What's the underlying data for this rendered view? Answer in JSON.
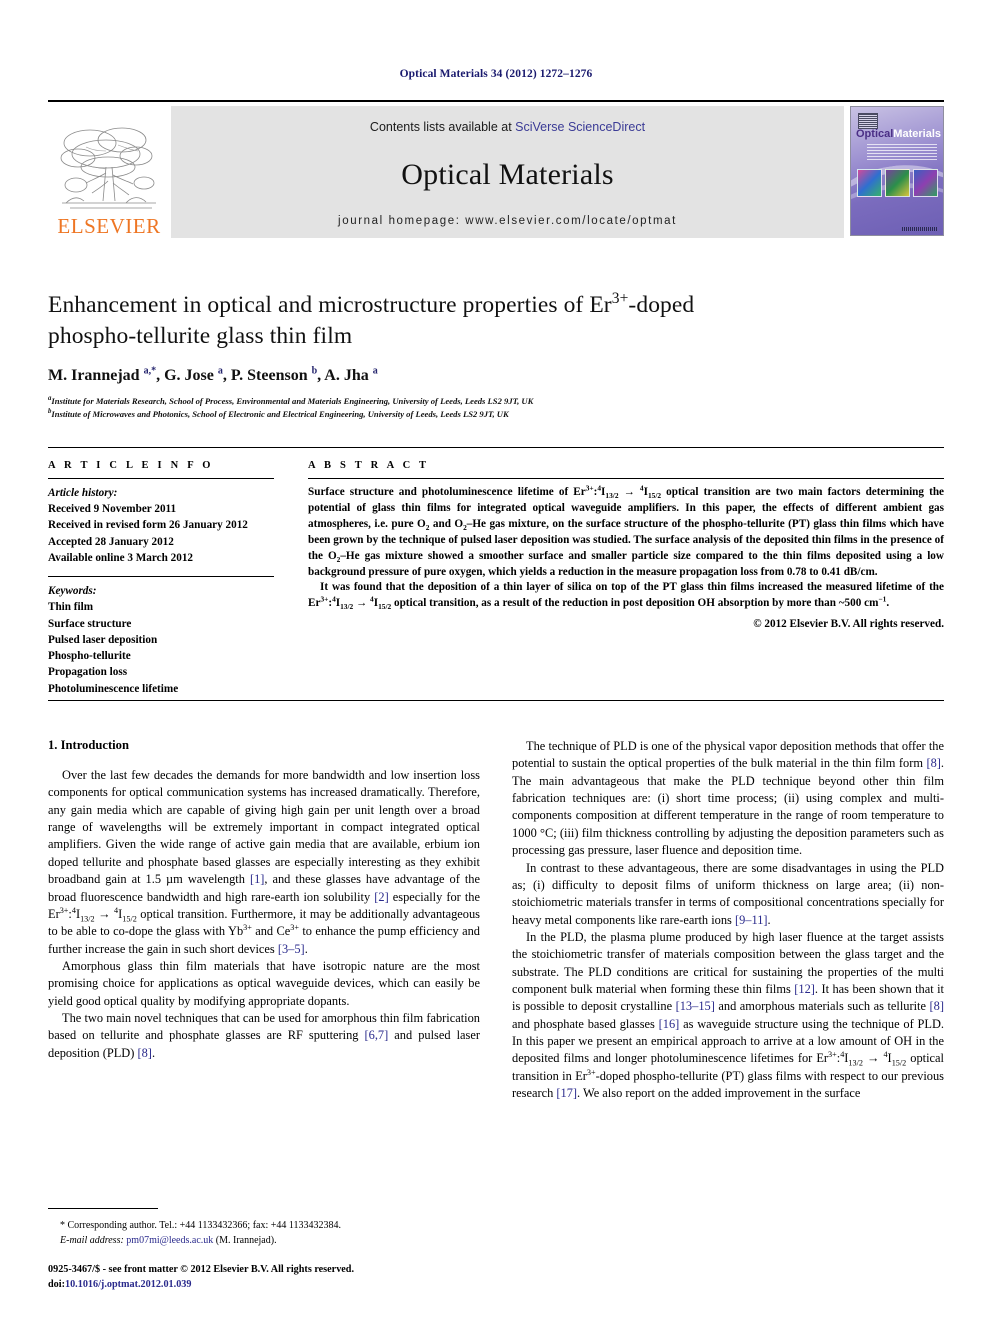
{
  "running_head": "Optical Materials 34 (2012) 1272–1276",
  "masthead": {
    "publisher_name": "ELSEVIER",
    "contents_prefix": "Contents lists available at ",
    "sciencedirect_link": "SciVerse ScienceDirect",
    "journal_title": "Optical Materials",
    "homepage_line": "journal homepage: www.elsevier.com/locate/optmat",
    "cover": {
      "title_part1": "Optical",
      "title_part2": "Materials"
    }
  },
  "article": {
    "title_line1": "Enhancement in optical and microstructure properties of Er",
    "title_sup1": "3+",
    "title_line1_end": "-doped",
    "title_line2": "phospho-tellurite glass thin film",
    "authors_html": "M. Irannejad <sup>a,*</sup>, G. Jose <sup>a</sup>, P. Steenson <sup>b</sup>, A. Jha <sup>a</sup>",
    "affiliation_a": "Institute for Materials Research, School of Process, Environmental and Materials Engineering, University of Leeds, Leeds LS2 9JT, UK",
    "affiliation_b": "Institute of Microwaves and Photonics, School of Electronic and Electrical Engineering, University of Leeds, Leeds LS2 9JT, UK"
  },
  "article_info": {
    "heading": "A R T I C L E   I N F O",
    "history_label": "Article history:",
    "history": [
      "Received 9 November 2011",
      "Received in revised form 26 January 2012",
      "Accepted 28 January 2012",
      "Available online 3 March 2012"
    ],
    "keywords_label": "Keywords:",
    "keywords": [
      "Thin film",
      "Surface structure",
      "Pulsed laser deposition",
      "Phospho-tellurite",
      "Propagation loss",
      "Photoluminescence lifetime"
    ]
  },
  "abstract": {
    "heading": "A B S T R A C T",
    "paragraph1_html": "Surface structure and photoluminescence lifetime of Er<sup>3+</sup>:<sup>4</sup>I<sub>13/2</sub> &#8594; <sup>4</sup>I<sub>15/2</sub> optical transition are two main factors determining the potential of glass thin films for integrated optical waveguide amplifiers. In this paper, the effects of different ambient gas atmospheres, i.e. pure O<sub>2</sub> and O<sub>2</sub>&#8211;He gas mixture, on the surface structure of the phospho-tellurite (PT) glass thin films which have been grown by the technique of pulsed laser deposition was studied. The surface analysis of the deposited thin films in the presence of the O<sub>2</sub>&#8211;He gas mixture showed a smoother surface and smaller particle size compared to the thin films deposited using a low background pressure of pure oxygen, which yields a reduction in the measure propagation loss from 0.78 to 0.41 dB/cm.",
    "paragraph2_html": "It was found that the deposition of a thin layer of silica on top of the PT glass thin films increased the measured lifetime of the Er<sup>3+</sup>:<sup>4</sup>I<sub>13/2</sub> &#8594; <sup>4</sup>I<sub>15/2</sub> optical transition, as a result of the reduction in post deposition OH absorption by more than ~500 cm<sup>&#8722;1</sup>.",
    "copyright": "© 2012 Elsevier B.V. All rights reserved."
  },
  "body": {
    "section_number_title": "1. Introduction",
    "left_paragraphs_html": [
      "Over the last few decades the demands for more bandwidth and low insertion loss components for optical communication systems has increased dramatically. Therefore, any gain media which are capable of giving high gain per unit length over a broad range of wavelengths will be extremely important in compact integrated optical amplifiers. Given the wide range of active gain media that are available, erbium ion doped tellurite and phosphate based glasses are especially interesting as they exhibit broadband gain at 1.5 &#181;m wavelength <span class=\"ref\">[1]</span>, and these glasses have advantage of the broad fluorescence bandwidth and high rare-earth ion solubility <span class=\"ref\">[2]</span> especially for the Er<sup>3+</sup>:<sup>4</sup>I<sub>13/2</sub> &#8594; <sup>4</sup>I<sub>15/2</sub> optical transition. Furthermore, it may be additionally advantageous to be able to co-dope the glass with Yb<sup>3+</sup> and Ce<sup>3+</sup> to enhance the pump efficiency and further increase the gain in such short devices <span class=\"ref\">[3&#8211;5]</span>.",
      "Amorphous glass thin film materials that have isotropic nature are the most promising choice for applications as optical waveguide devices, which can easily be yield good optical quality by modifying appropriate dopants.",
      "The two main novel techniques that can be used for amorphous thin film fabrication based on tellurite and phosphate glasses are RF sputtering <span class=\"ref\">[6,7]</span> and pulsed laser deposition (PLD) <span class=\"ref\">[8]</span>."
    ],
    "right_paragraphs_html": [
      "The technique of PLD is one of the physical vapor deposition methods that offer the potential to sustain the optical properties of the bulk material in the thin film form <span class=\"ref\">[8]</span>. The main advantageous that make the PLD technique beyond other thin film fabrication techniques are: (i) short time process; (ii) using complex and multi-components composition at different temperature in the range of room temperature to 1000 &#176;C; (iii) film thickness controlling by adjusting the deposition parameters such as processing gas pressure, laser fluence and deposition time.",
      "In contrast to these advantageous, there are some disadvantages in using the PLD as; (i) difficulty to deposit films of uniform thickness on large area; (ii) non-stoichiometric materials transfer in terms of compositional concentrations specially for heavy metal components like rare-earth ions <span class=\"ref\">[9&#8211;11]</span>.",
      "In the PLD, the plasma plume produced by high laser fluence at the target assists the stoichiometric transfer of materials composition between the glass target and the substrate. The PLD conditions are critical for sustaining the properties of the multi component bulk material when forming these thin films <span class=\"ref\">[12]</span>. It has been shown that it is possible to deposit crystalline <span class=\"ref\">[13&#8211;15]</span> and amorphous materials such as tellurite <span class=\"ref\">[8]</span> and phosphate based glasses <span class=\"ref\">[16]</span> as waveguide structure using the technique of PLD. In this paper we present an empirical approach to arrive at a low amount of OH in the deposited films and longer photoluminescence lifetimes for Er<sup>3+</sup>:<sup>4</sup>I<sub>13/2</sub> &#8594; <sup>4</sup>I<sub>15/2</sub> optical transition in Er<sup>3+</sup>-doped phospho-tellurite (PT) glass films with respect to our previous research <span class=\"ref\">[17]</span>. We also report on the added improvement in the surface"
    ]
  },
  "footnote": {
    "corresponding_html": "<span class=\"star\">*</span> Corresponding author. Tel.: +44 1133432366; fax: +44 1133432384.",
    "email_label": "E-mail address:",
    "email_link": "pm07mi@leeds.ac.uk",
    "email_owner": "(M. Irannejad)."
  },
  "imprint": {
    "issn_line": "0925-3467/$ - see front matter © 2012 Elsevier B.V. All rights reserved.",
    "doi_label": "doi:",
    "doi_value": "10.1016/j.optmat.2012.01.039"
  }
}
